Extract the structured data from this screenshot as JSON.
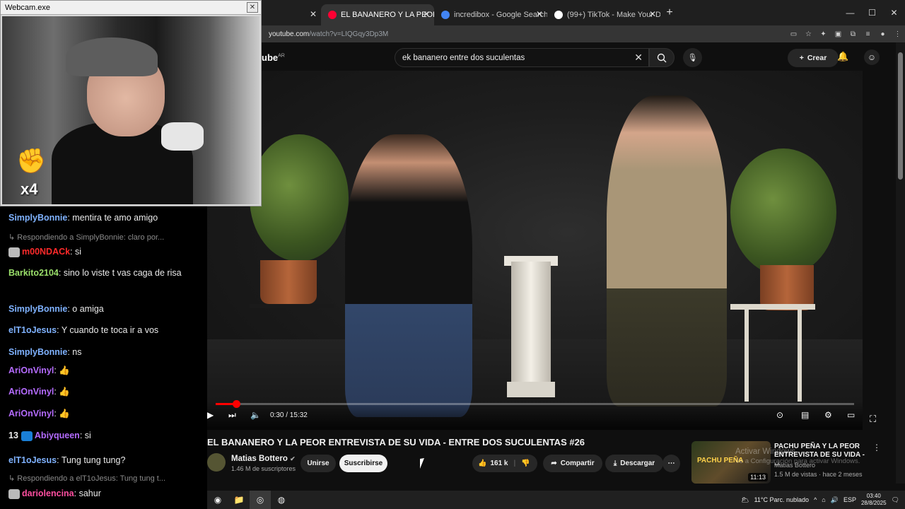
{
  "browser": {
    "tabs": [
      {
        "label": "EL BANANERO Y LA PEOR ENTI",
        "active": true,
        "icon_color": "#ff0033"
      },
      {
        "label": "incredibox - Google Search",
        "active": false,
        "icon_color": "#4285f4"
      },
      {
        "label": "(99+) TikTok - Make Your Day",
        "active": false,
        "icon_color": "#ffffff"
      }
    ],
    "url_domain": "youtube.com",
    "url_path": "/watch?v=LIQGqy3Dp3M"
  },
  "youtube": {
    "logo": "ube",
    "country": "AR",
    "search_value": "ek bananero entre dos suculentas",
    "create_label": "Crear"
  },
  "player": {
    "time": "0:30 / 15:32",
    "progress": 0.032
  },
  "video": {
    "title": "EL BANANERO Y LA PEOR ENTREVISTA DE SU VIDA - ENTRE DOS SUCULENTAS #26",
    "channel": "Matias Bottero",
    "subscribers": "1.46 M de suscriptores",
    "join_label": "Unirse",
    "subscribe_label": "Suscribirse",
    "likes": "161 k",
    "share_label": "Compartir",
    "download_label": "Descargar"
  },
  "suggestion": {
    "title": "PACHU PEÑA Y LA PEOR ENTREVISTA DE SU VIDA - ...",
    "thumb_text": "PACHU PEÑA",
    "channel": "Matias Bottero",
    "meta": "1.5 M de vistas · hace 2 meses",
    "duration": "11:13"
  },
  "windows_watermark": {
    "line1": "Activar Windows",
    "line2": "Ve a Configuración para activar Windows."
  },
  "webcam": {
    "title": "Webcam.exe",
    "multiplier": "x4"
  },
  "chat": [
    {
      "type": "msg",
      "user": "SimplyBonnie",
      "color": "#7fb2ff",
      "text": ": mentira te amo amigo"
    },
    {
      "type": "reply",
      "text": "↳ Respondiendo a SimplyBonnie: claro por..."
    },
    {
      "type": "msg",
      "user": "m00NDACk",
      "color": "#ff2a2a",
      "text": ": si",
      "badge": "#bbbbbb"
    },
    {
      "type": "msg",
      "user": "Barkito2104",
      "color": "#9be06b",
      "text": ": sino lo viste t vas caga de risa"
    },
    {
      "type": "msg",
      "user": "SimplyBonnie",
      "color": "#7fb2ff",
      "text": ": o amiga"
    },
    {
      "type": "msg",
      "user": "elT1oJesus",
      "color": "#7fb2ff",
      "text": ": Y cuando te toca ir a vos"
    },
    {
      "type": "msg",
      "user": "SimplyBonnie",
      "color": "#7fb2ff",
      "text": ": ns"
    },
    {
      "type": "msg",
      "user": "AriOnVinyl",
      "color": "#b46bff",
      "text": ": 👍"
    },
    {
      "type": "msg",
      "user": "AriOnVinyl",
      "color": "#b46bff",
      "text": ": 👍"
    },
    {
      "type": "msg",
      "user": "AriOnVinyl",
      "color": "#b46bff",
      "text": ": 👍"
    },
    {
      "type": "msg",
      "user": "Abiyqueen",
      "color": "#b46bff",
      "text": ": si",
      "prefix": "13",
      "badge": "#1a7fd6"
    },
    {
      "type": "msg",
      "user": "elT1oJesus",
      "color": "#7fb2ff",
      "text": ": Tung tung tung?"
    },
    {
      "type": "reply",
      "text": "↳ Respondiendo a elT1oJesus: Tung tung t..."
    },
    {
      "type": "msg",
      "user": "dariolencina",
      "color": "#ff4fa0",
      "text": ": sahur",
      "badge": "#bbbbbb"
    }
  ],
  "taskbar": {
    "weather": "11°C  Parc. nublado",
    "lang": "ESP",
    "time": "03:40",
    "date": "28/8/2025"
  }
}
